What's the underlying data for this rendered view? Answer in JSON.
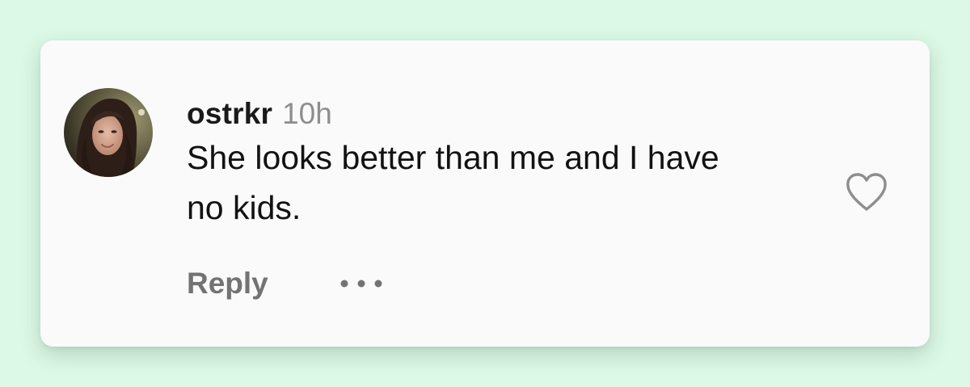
{
  "comment": {
    "username": "ostrkr",
    "timestamp": "10h",
    "text": "She looks better than me and I have no kids.",
    "reply_label": "Reply"
  },
  "icons": {
    "avatar": "user-profile-photo",
    "more": "more-options-icon",
    "like": "heart-outline-icon"
  },
  "colors": {
    "background": "#dcf8e6",
    "card": "#fafafa",
    "username": "#1a1a1a",
    "timestamp": "#8e8e8e",
    "text": "#121212",
    "action": "#737373",
    "heart_stroke": "#8e8e8e"
  }
}
